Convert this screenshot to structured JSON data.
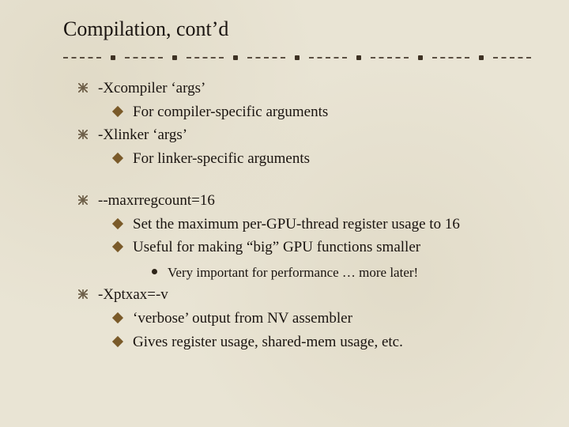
{
  "title": "Compilation, cont’d",
  "groups": [
    {
      "items": [
        {
          "level": 1,
          "text": "-Xcompiler ‘args’"
        },
        {
          "level": 2,
          "text": "For compiler-specific arguments"
        },
        {
          "level": 1,
          "text": "-Xlinker ‘args’"
        },
        {
          "level": 2,
          "text": "For linker-specific arguments"
        }
      ]
    },
    {
      "items": [
        {
          "level": 1,
          "text": "--maxrregcount=16"
        },
        {
          "level": 2,
          "text": "Set the maximum per-GPU-thread register usage to 16"
        },
        {
          "level": 2,
          "text": "Useful for making “big” GPU functions smaller"
        },
        {
          "level": 3,
          "text": "Very important for performance … more later!"
        },
        {
          "level": 1,
          "text": "-Xptxax=-v"
        },
        {
          "level": 2,
          "text": "‘verbose’ output from NV assembler"
        },
        {
          "level": 2,
          "text": "Gives register usage, shared-mem usage, etc."
        }
      ]
    }
  ]
}
